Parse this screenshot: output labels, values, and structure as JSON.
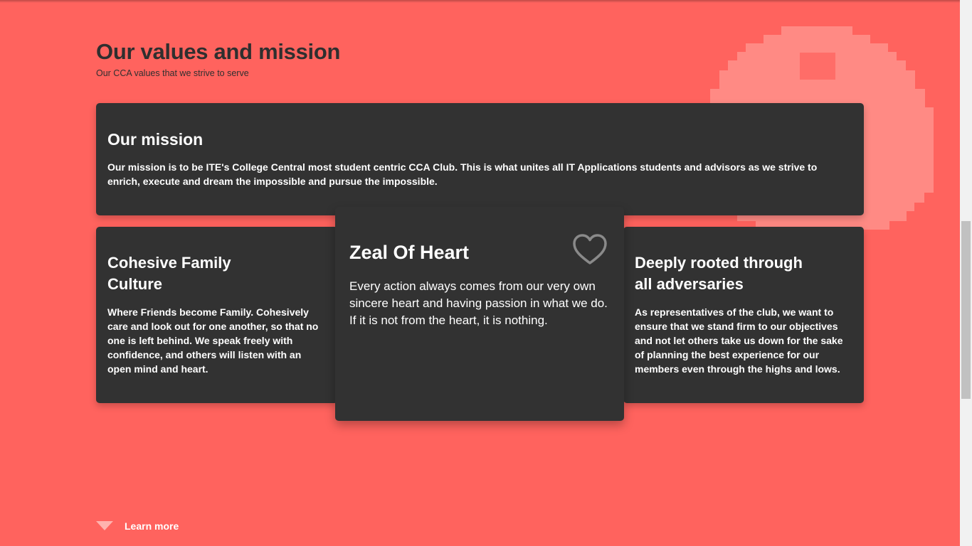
{
  "section": {
    "title": "Our values and mission",
    "subtitle": "Our CCA values that we strive to serve"
  },
  "mission": {
    "title": "Our mission",
    "text": "Our mission is to be ITE's College Central most student centric CCA Club. This is what unites all IT Applications students and advisors as we strive to enrich, execute and dream the impossible and pursue the impossible."
  },
  "values": {
    "left": {
      "title_line1": "Cohesive Family",
      "title_line2": "Culture",
      "text": "Where Friends become Family. Cohesively care and look out for one another, so that no one is left behind. We speak freely with confidence, and others will listen with an open mind and heart."
    },
    "center": {
      "title": "Zeal Of Heart",
      "text": "Every action always comes from our very own sincere heart and having passion in what we do. If it is not from the heart, it is nothing.",
      "icon": "heart-outline-icon"
    },
    "right": {
      "title_line1": "Deeply rooted through",
      "title_line2": "all adversaries",
      "text": "As representatives of the club, we want to ensure that we stand firm to our objectives and not let others take us down for the sake of planning the best experience for our members even through the highs and lows."
    }
  },
  "footer": {
    "learn_more": "Learn more",
    "icon": "triangle-down-icon"
  },
  "colors": {
    "background": "#ff635e",
    "card": "#323232",
    "decoration": "#ff8a84",
    "text_dark": "#2f2f2f",
    "text_light": "#ffffff"
  }
}
